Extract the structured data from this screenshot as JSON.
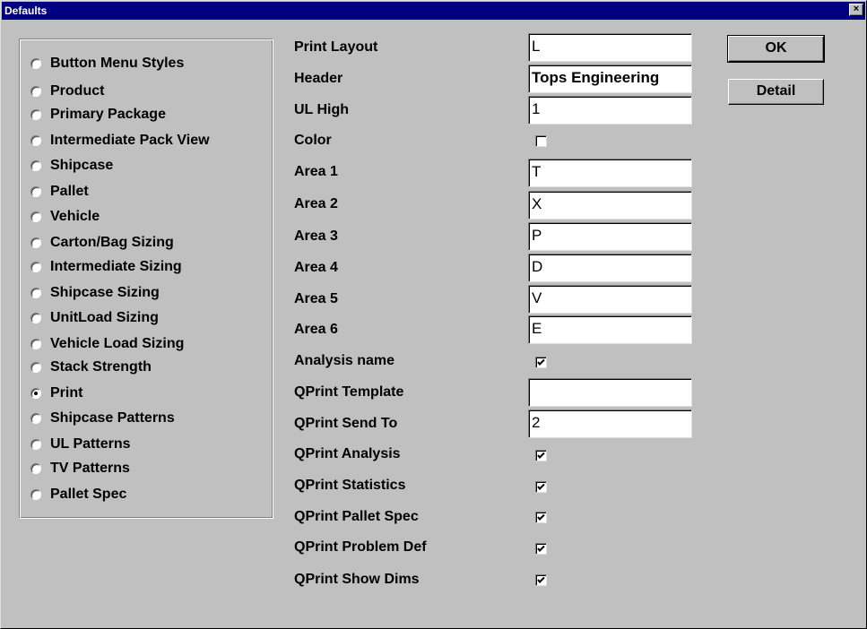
{
  "window": {
    "title": "Defaults",
    "close_label": "×"
  },
  "categories": [
    {
      "label": "Button Menu Styles",
      "selected": false
    },
    {
      "label": "Product",
      "selected": false
    },
    {
      "label": "Primary Package",
      "selected": false
    },
    {
      "label": "Intermediate Pack View",
      "selected": false
    },
    {
      "label": "Shipcase",
      "selected": false
    },
    {
      "label": "Pallet",
      "selected": false
    },
    {
      "label": "Vehicle",
      "selected": false
    },
    {
      "label": "Carton/Bag Sizing",
      "selected": false
    },
    {
      "label": "Intermediate Sizing",
      "selected": false
    },
    {
      "label": "Shipcase Sizing",
      "selected": false
    },
    {
      "label": "UnitLoad Sizing",
      "selected": false
    },
    {
      "label": "Vehicle Load Sizing",
      "selected": false
    },
    {
      "label": "Stack Strength",
      "selected": false
    },
    {
      "label": "Print",
      "selected": true
    },
    {
      "label": "Shipcase Patterns",
      "selected": false
    },
    {
      "label": "UL Patterns",
      "selected": false
    },
    {
      "label": "TV Patterns",
      "selected": false
    },
    {
      "label": "Pallet Spec",
      "selected": false
    }
  ],
  "fields": [
    {
      "label": "Print Layout",
      "type": "text",
      "value": "L"
    },
    {
      "label": "Header",
      "type": "text",
      "value": "Tops Engineering"
    },
    {
      "label": "UL High",
      "type": "text",
      "value": "1"
    },
    {
      "label": "Color",
      "type": "checkbox",
      "checked": false
    },
    {
      "label": "Area 1",
      "type": "text",
      "value": "T"
    },
    {
      "label": "Area 2",
      "type": "text",
      "value": "X"
    },
    {
      "label": "Area 3",
      "type": "text",
      "value": "P"
    },
    {
      "label": "Area 4",
      "type": "text",
      "value": "D"
    },
    {
      "label": "Area 5",
      "type": "text",
      "value": "V"
    },
    {
      "label": "Area 6",
      "type": "text",
      "value": "E"
    },
    {
      "label": "Analysis name",
      "type": "checkbox",
      "checked": true
    },
    {
      "label": "QPrint Template",
      "type": "text",
      "value": ""
    },
    {
      "label": "QPrint Send To",
      "type": "text",
      "value": "2"
    },
    {
      "label": "QPrint Analysis",
      "type": "checkbox",
      "checked": true
    },
    {
      "label": "QPrint Statistics",
      "type": "checkbox",
      "checked": true
    },
    {
      "label": "QPrint Pallet Spec",
      "type": "checkbox",
      "checked": true
    },
    {
      "label": "QPrint Problem Def",
      "type": "checkbox",
      "checked": true
    },
    {
      "label": "QPrint Show Dims",
      "type": "checkbox",
      "checked": true
    }
  ],
  "buttons": {
    "ok_label": "OK",
    "detail_label": "Detail"
  }
}
